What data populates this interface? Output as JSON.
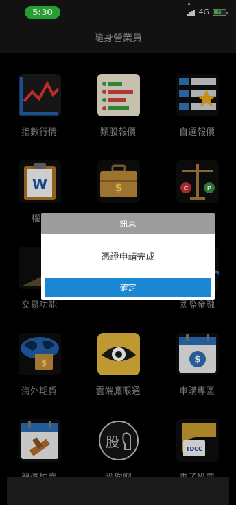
{
  "status_bar": {
    "time": "5:30",
    "network": "4G",
    "accent_time_color": "#2dbb3a",
    "battery_color": "#4fc14f"
  },
  "header": {
    "title": "隨身營業員"
  },
  "grid": {
    "items": [
      {
        "label": "指數行情",
        "icon": "line-chart-icon"
      },
      {
        "label": "類股報價",
        "icon": "bar-list-icon"
      },
      {
        "label": "自選報價",
        "icon": "star-list-icon"
      },
      {
        "label": "權",
        "icon": "word-document-icon"
      },
      {
        "label": "",
        "icon": "briefcase-dollar-icon"
      },
      {
        "label": "",
        "icon": "scale-cp-icon"
      },
      {
        "label": "交易功能",
        "icon": "trade-icon"
      },
      {
        "label": "",
        "icon": "warrant-zone-icon"
      },
      {
        "label": "國際金融",
        "icon": "globe-finance-icon"
      },
      {
        "label": "海外期貨",
        "icon": "world-briefcase-icon"
      },
      {
        "label": "雲端鷹眼通",
        "icon": "eye-icon"
      },
      {
        "label": "申購專區",
        "icon": "calendar-dollar-icon"
      },
      {
        "label": "競價拍賣",
        "icon": "calendar-gavel-icon"
      },
      {
        "label": "股狗網",
        "icon": "stock-dog-logo-icon"
      },
      {
        "label": "電子投票",
        "icon": "tdcc-vote-icon"
      }
    ]
  },
  "dialog": {
    "title": "訊息",
    "message": "憑證申請完成",
    "confirm_label": "確定",
    "button_color": "#1b87d3"
  }
}
